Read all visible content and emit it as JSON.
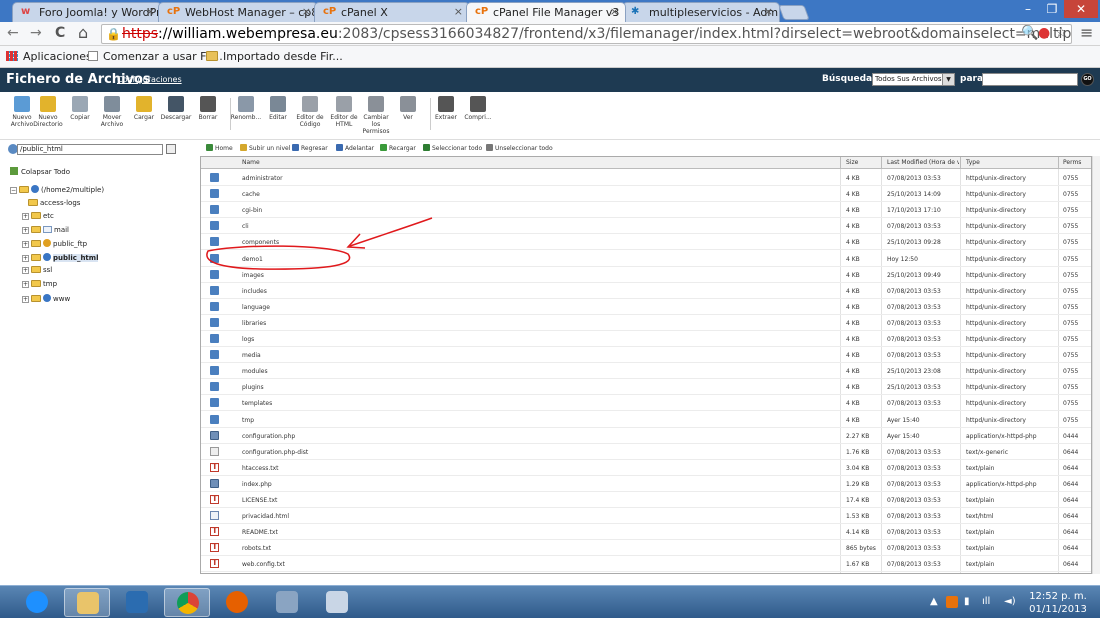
{
  "browser": {
    "tabs": [
      {
        "label": "Foro Joomla! y WordPress",
        "favicon": "w"
      },
      {
        "label": "WebHost Manager – cp80",
        "favicon": "cP"
      },
      {
        "label": "cPanel X",
        "favicon": "cP"
      },
      {
        "label": "cPanel File Manager v3",
        "favicon": "cP"
      },
      {
        "label": "multipleservicios - Admin",
        "favicon": "joomla-icon"
      }
    ],
    "tab_close": "×",
    "window_controls": {
      "minimize": "–",
      "maximize": "❐",
      "close": "✕"
    },
    "nav": {
      "back": "←",
      "forward": "→",
      "reload": "C",
      "home": "⌂"
    },
    "url": {
      "scheme": "https",
      "host": "://william.webempresa.eu",
      "path": ":2083/cpsess3166034827/frontend/x3/filemanager/index.html?dirselect=webroot&domainselect=multipleservicios.com&dir=%2"
    },
    "menu_icon": "≡",
    "bookmarks": [
      {
        "label": "Aplicaciones",
        "icon": "apps-icon"
      },
      {
        "label": "Comenzar a usar Fir...",
        "icon": "page-icon"
      },
      {
        "label": "Importado desde Fir...",
        "icon": "folder-icon"
      }
    ]
  },
  "cpanel": {
    "title": "Fichero de Archivos",
    "config_link": "Configuraciones",
    "search_label": "Búsqueda",
    "search_option": "Todos Sus Archivos",
    "para_label": "para",
    "go_label": "GO",
    "tools": [
      {
        "label": "Nuevo Archivo",
        "icon": "new-file-icon",
        "color": "#5b9bd5"
      },
      {
        "label": "Nuevo Directorio",
        "icon": "new-folder-icon",
        "color": "#e2b32c"
      },
      {
        "label": "Copiar",
        "icon": "copy-icon",
        "color": "#9aa7b4"
      },
      {
        "label": "Mover Archivo",
        "icon": "move-icon",
        "color": "#7f8d9b"
      },
      {
        "label": "Cargar",
        "icon": "upload-icon",
        "color": "#e2b32c"
      },
      {
        "label": "Descargar",
        "icon": "download-icon",
        "color": "#445566"
      },
      {
        "label": "Borrar",
        "icon": "delete-icon",
        "color": "#555"
      },
      {
        "label": "Renomb...",
        "icon": "rename-icon",
        "color": "#8a98a8"
      },
      {
        "label": "Editar",
        "icon": "edit-icon",
        "color": "#7a8896"
      },
      {
        "label": "Editor de Código",
        "icon": "code-editor-icon",
        "color": "#9aa0a8"
      },
      {
        "label": "Editor de HTML",
        "icon": "html-editor-icon",
        "color": "#9aa0a8"
      },
      {
        "label": "Cambiar los Permisos",
        "icon": "permissions-icon",
        "color": "#8a9098"
      },
      {
        "label": "Ver",
        "icon": "view-icon",
        "color": "#8a9098"
      },
      {
        "label": "Extraer",
        "icon": "extract-icon",
        "color": "#555"
      },
      {
        "label": "Compri...",
        "icon": "compress-icon",
        "color": "#555"
      }
    ],
    "path_value": "/public_html",
    "collapse_all": "Colapsar Todo",
    "tree": [
      {
        "label": "(/home2/multiple)",
        "icon": "home-folder-icon",
        "pm": "−",
        "selected": false
      },
      {
        "label": "access-logs",
        "icon": "folder-icon",
        "pm": "",
        "selected": false
      },
      {
        "label": "etc",
        "icon": "folder-icon",
        "pm": "+",
        "selected": false
      },
      {
        "label": "mail",
        "icon": "mail-folder-icon",
        "pm": "+",
        "selected": false
      },
      {
        "label": "public_ftp",
        "icon": "ftp-folder-icon",
        "pm": "+",
        "selected": false
      },
      {
        "label": "public_html",
        "icon": "globe-folder-icon",
        "pm": "+",
        "selected": true
      },
      {
        "label": "ssl",
        "icon": "folder-icon",
        "pm": "+",
        "selected": false
      },
      {
        "label": "tmp",
        "icon": "folder-icon",
        "pm": "+",
        "selected": false
      },
      {
        "label": "www",
        "icon": "globe-folder-icon",
        "pm": "+",
        "selected": false
      }
    ],
    "navbar": [
      {
        "label": "Home",
        "icon": "home-icon",
        "color": "#3a8a3a"
      },
      {
        "label": "Subir un nivel",
        "icon": "up-level-icon",
        "color": "#d4a72c"
      },
      {
        "label": "Regresar",
        "icon": "back-arrow-icon",
        "color": "#3a6ab0"
      },
      {
        "label": "Adelantar",
        "icon": "forward-arrow-icon",
        "color": "#3a6ab0"
      },
      {
        "label": "Recargar",
        "icon": "reload-icon",
        "color": "#3a9a3a"
      },
      {
        "label": "Seleccionar todo",
        "icon": "checkbox-icon",
        "color": "#2e7d32"
      },
      {
        "label": "Unseleccionar todo",
        "icon": "uncheck-icon",
        "color": "#777"
      }
    ],
    "columns": {
      "name": "Name",
      "size": "Size",
      "modified": "Last Modified (Hora de ver",
      "type": "Type",
      "perms": "Perms"
    },
    "files": [
      {
        "name": "administrator",
        "size": "4 KB",
        "modified": "07/08/2013 03:53",
        "type": "httpd/unix-directory",
        "perms": "0755",
        "kind": "dir"
      },
      {
        "name": "cache",
        "size": "4 KB",
        "modified": "25/10/2013 14:09",
        "type": "httpd/unix-directory",
        "perms": "0755",
        "kind": "dir"
      },
      {
        "name": "cgi-bin",
        "size": "4 KB",
        "modified": "17/10/2013 17:10",
        "type": "httpd/unix-directory",
        "perms": "0755",
        "kind": "dir"
      },
      {
        "name": "cli",
        "size": "4 KB",
        "modified": "07/08/2013 03:53",
        "type": "httpd/unix-directory",
        "perms": "0755",
        "kind": "dir"
      },
      {
        "name": "components",
        "size": "4 KB",
        "modified": "25/10/2013 09:28",
        "type": "httpd/unix-directory",
        "perms": "0755",
        "kind": "dir"
      },
      {
        "name": "demo1",
        "size": "4 KB",
        "modified": "Hoy 12:50",
        "type": "httpd/unix-directory",
        "perms": "0755",
        "kind": "dir"
      },
      {
        "name": "images",
        "size": "4 KB",
        "modified": "25/10/2013 09:49",
        "type": "httpd/unix-directory",
        "perms": "0755",
        "kind": "dir"
      },
      {
        "name": "includes",
        "size": "4 KB",
        "modified": "07/08/2013 03:53",
        "type": "httpd/unix-directory",
        "perms": "0755",
        "kind": "dir"
      },
      {
        "name": "language",
        "size": "4 KB",
        "modified": "07/08/2013 03:53",
        "type": "httpd/unix-directory",
        "perms": "0755",
        "kind": "dir"
      },
      {
        "name": "libraries",
        "size": "4 KB",
        "modified": "07/08/2013 03:53",
        "type": "httpd/unix-directory",
        "perms": "0755",
        "kind": "dir"
      },
      {
        "name": "logs",
        "size": "4 KB",
        "modified": "07/08/2013 03:53",
        "type": "httpd/unix-directory",
        "perms": "0755",
        "kind": "dir"
      },
      {
        "name": "media",
        "size": "4 KB",
        "modified": "07/08/2013 03:53",
        "type": "httpd/unix-directory",
        "perms": "0755",
        "kind": "dir"
      },
      {
        "name": "modules",
        "size": "4 KB",
        "modified": "25/10/2013 23:08",
        "type": "httpd/unix-directory",
        "perms": "0755",
        "kind": "dir"
      },
      {
        "name": "plugins",
        "size": "4 KB",
        "modified": "25/10/2013 03:53",
        "type": "httpd/unix-directory",
        "perms": "0755",
        "kind": "dir"
      },
      {
        "name": "templates",
        "size": "4 KB",
        "modified": "07/08/2013 03:53",
        "type": "httpd/unix-directory",
        "perms": "0755",
        "kind": "dir"
      },
      {
        "name": "tmp",
        "size": "4 KB",
        "modified": "Ayer 15:40",
        "type": "httpd/unix-directory",
        "perms": "0755",
        "kind": "dir"
      },
      {
        "name": "configuration.php",
        "size": "2.27 KB",
        "modified": "Ayer 15:40",
        "type": "application/x-httpd-php",
        "perms": "0444",
        "kind": "php"
      },
      {
        "name": "configuration.php-dist",
        "size": "1.76 KB",
        "modified": "07/08/2013 03:53",
        "type": "text/x-generic",
        "perms": "0644",
        "kind": "generic"
      },
      {
        "name": "htaccess.txt",
        "size": "3.04 KB",
        "modified": "07/08/2013 03:53",
        "type": "text/plain",
        "perms": "0644",
        "kind": "txt"
      },
      {
        "name": "index.php",
        "size": "1.29 KB",
        "modified": "07/08/2013 03:53",
        "type": "application/x-httpd-php",
        "perms": "0644",
        "kind": "php"
      },
      {
        "name": "LICENSE.txt",
        "size": "17.4 KB",
        "modified": "07/08/2013 03:53",
        "type": "text/plain",
        "perms": "0644",
        "kind": "txt"
      },
      {
        "name": "privacidad.html",
        "size": "1.53 KB",
        "modified": "07/08/2013 03:53",
        "type": "text/html",
        "perms": "0644",
        "kind": "html"
      },
      {
        "name": "README.txt",
        "size": "4.14 KB",
        "modified": "07/08/2013 03:53",
        "type": "text/plain",
        "perms": "0644",
        "kind": "txt"
      },
      {
        "name": "robots.txt",
        "size": "865 bytes",
        "modified": "07/08/2013 03:53",
        "type": "text/plain",
        "perms": "0644",
        "kind": "txt"
      },
      {
        "name": "web.config.txt",
        "size": "1.67 KB",
        "modified": "07/08/2013 03:53",
        "type": "text/plain",
        "perms": "0644",
        "kind": "txt"
      }
    ]
  },
  "taskbar": {
    "apps": [
      {
        "icon": "ie-icon",
        "color": "#1e90ff",
        "active": false
      },
      {
        "icon": "explorer-icon",
        "color": "#e9c46a",
        "active": true
      },
      {
        "icon": "word-icon",
        "color": "#2b6cb0",
        "active": false
      },
      {
        "icon": "chrome-icon",
        "color": "#db4437",
        "active": true
      },
      {
        "icon": "firefox-icon",
        "color": "#e66000",
        "active": false
      },
      {
        "icon": "network-icon",
        "color": "#8aa4c2",
        "active": false
      },
      {
        "icon": "calculator-icon",
        "color": "#c9d6e6",
        "active": false
      }
    ],
    "time": "12:52 p. m.",
    "date": "01/11/2013"
  }
}
